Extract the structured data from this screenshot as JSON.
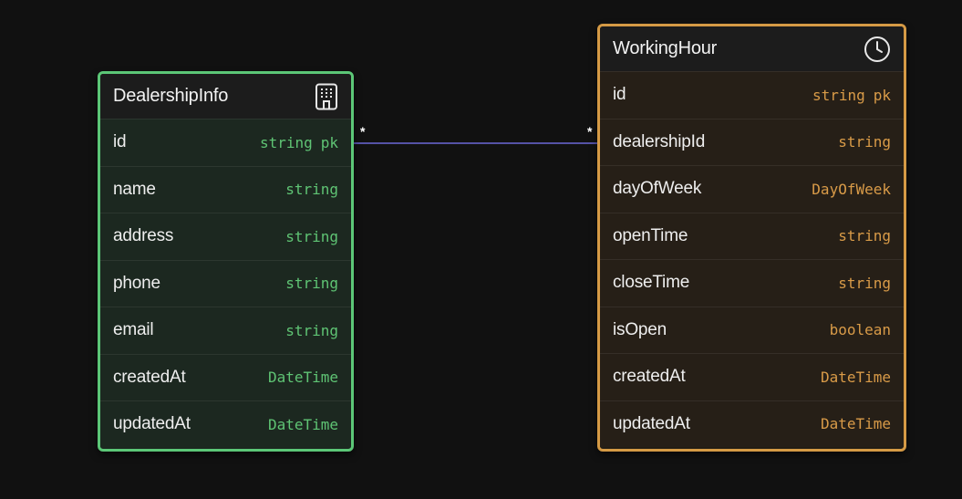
{
  "colors": {
    "background": "#111111",
    "dealership_border": "#5cc777",
    "dealership_type_text": "#5fc474",
    "workinghour_border": "#d59a45",
    "workinghour_type_text": "#d99b48",
    "relation_line": "#6c68d8"
  },
  "tables": {
    "dealership": {
      "name": "DealershipInfo",
      "icon": "building-icon",
      "fields": [
        {
          "name": "id",
          "type": "string",
          "key": "pk"
        },
        {
          "name": "name",
          "type": "string",
          "key": ""
        },
        {
          "name": "address",
          "type": "string",
          "key": ""
        },
        {
          "name": "phone",
          "type": "string",
          "key": ""
        },
        {
          "name": "email",
          "type": "string",
          "key": ""
        },
        {
          "name": "createdAt",
          "type": "DateTime",
          "key": ""
        },
        {
          "name": "updatedAt",
          "type": "DateTime",
          "key": ""
        }
      ]
    },
    "workinghour": {
      "name": "WorkingHour",
      "icon": "clock-icon",
      "fields": [
        {
          "name": "id",
          "type": "string",
          "key": "pk"
        },
        {
          "name": "dealershipId",
          "type": "string",
          "key": ""
        },
        {
          "name": "dayOfWeek",
          "type": "DayOfWeek",
          "key": ""
        },
        {
          "name": "openTime",
          "type": "string",
          "key": ""
        },
        {
          "name": "closeTime",
          "type": "string",
          "key": ""
        },
        {
          "name": "isOpen",
          "type": "boolean",
          "key": ""
        },
        {
          "name": "createdAt",
          "type": "DateTime",
          "key": ""
        },
        {
          "name": "updatedAt",
          "type": "DateTime",
          "key": ""
        }
      ]
    }
  },
  "relations": [
    {
      "from": "DealershipInfo.id",
      "to": "WorkingHour.dealershipId",
      "from_cardinality": "*",
      "to_cardinality": "*"
    }
  ]
}
